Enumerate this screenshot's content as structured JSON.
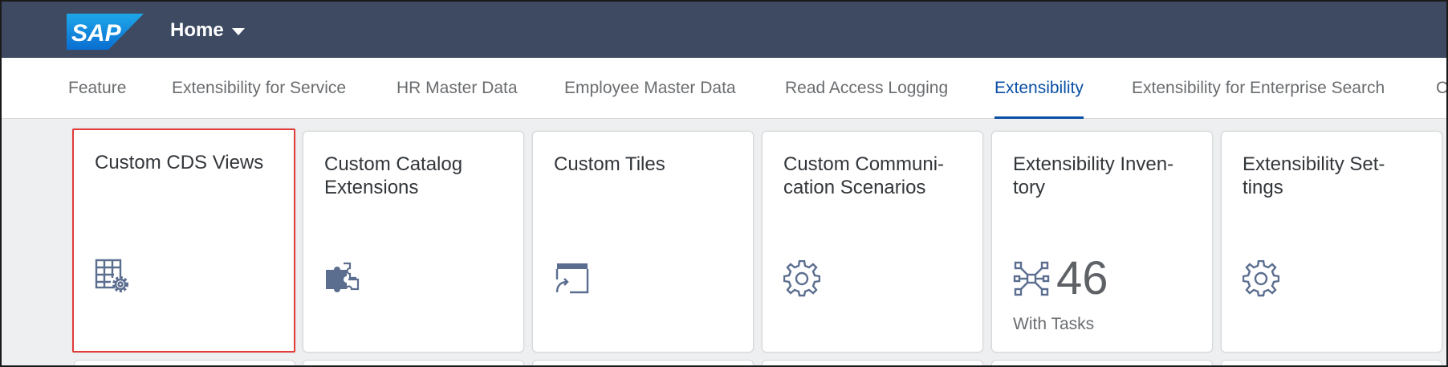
{
  "shell": {
    "logo_text": "SAP",
    "home_label": "Home"
  },
  "anchor_bar": {
    "items": [
      {
        "label": "Feature"
      },
      {
        "label": "Extensibility for Service"
      },
      {
        "label": "HR Master Data"
      },
      {
        "label": "Employee Master Data"
      },
      {
        "label": "Read Access Logging"
      },
      {
        "label": "Extensibility",
        "active": true
      },
      {
        "label": "Extensibility for Enterprise Search"
      },
      {
        "label": "C"
      }
    ]
  },
  "tiles": [
    {
      "title": "Custom CDS Views",
      "icon": "grid-gear-icon",
      "selected": true
    },
    {
      "title": "Custom Catalog Extensions",
      "icon": "puzzle-icon"
    },
    {
      "title": "Custom Tiles",
      "icon": "tile-add-icon"
    },
    {
      "title": "Custom Communi-cation Scenarios",
      "icon": "gear-icon"
    },
    {
      "title": "Extensibility Inven-tory",
      "icon": "network-icon",
      "kpi": "46",
      "kpi_subtitle": "With Tasks"
    },
    {
      "title": "Extensibility Set-tings",
      "icon": "gear-icon"
    }
  ],
  "colors": {
    "shell_bg": "#3d4a62",
    "active_tab": "#0a4fa3",
    "icon": "#5b6e8f",
    "selection_border": "#e33a3a"
  }
}
